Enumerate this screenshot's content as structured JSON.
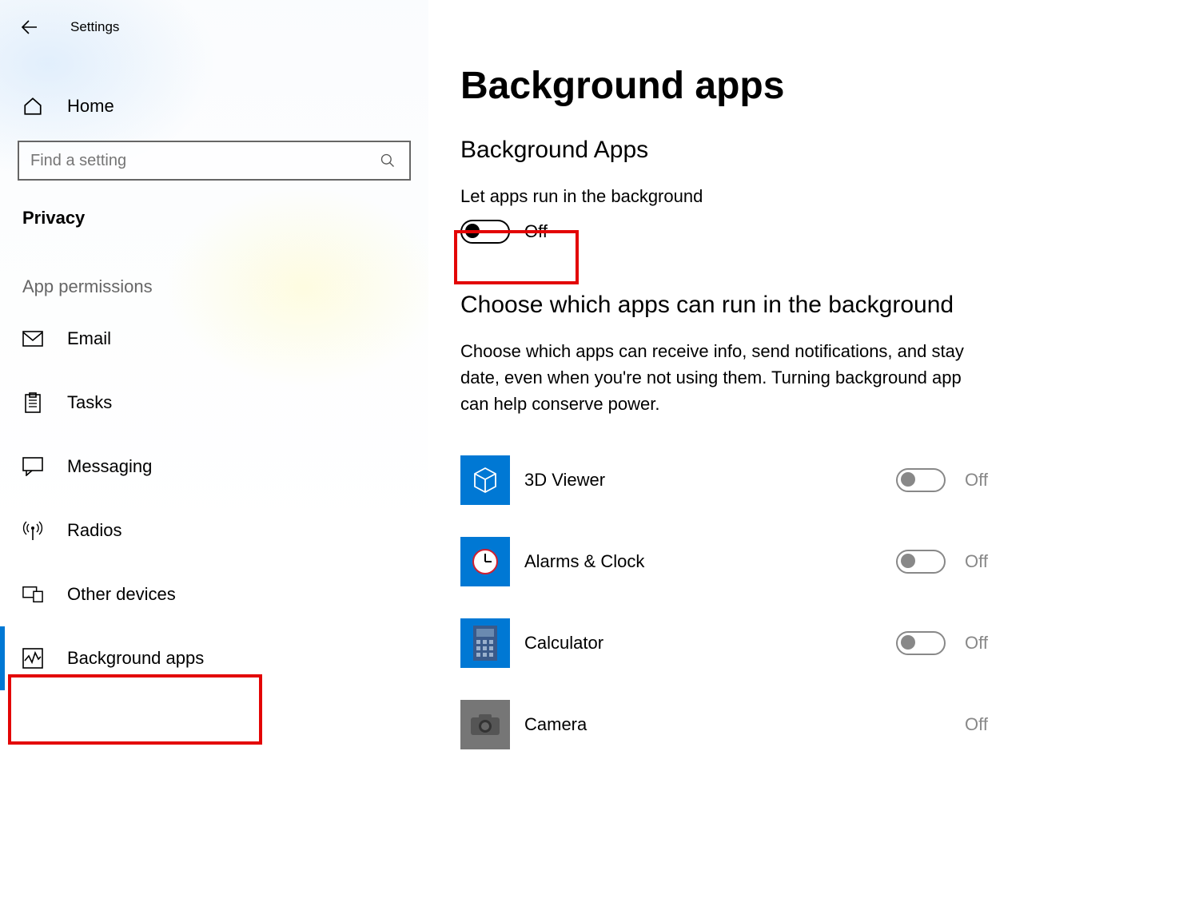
{
  "app_title": "Settings",
  "sidebar": {
    "home": "Home",
    "search_placeholder": "Find a setting",
    "category": "Privacy",
    "section": "App permissions",
    "items": [
      {
        "label": "Email"
      },
      {
        "label": "Tasks"
      },
      {
        "label": "Messaging"
      },
      {
        "label": "Radios"
      },
      {
        "label": "Other devices"
      },
      {
        "label": "Background apps"
      }
    ]
  },
  "main": {
    "page_title": "Background apps",
    "sub_title": "Background Apps",
    "master_label": "Let apps run in the background",
    "master_state": "Off",
    "choose_heading": "Choose which apps can run in the background",
    "choose_desc_l1": "Choose which apps can receive info, send notifications, and stay",
    "choose_desc_l2": "date, even when you're not using them. Turning background app",
    "choose_desc_l3": "can help conserve power.",
    "apps": [
      {
        "name": "3D Viewer",
        "state": "Off",
        "tile": "#0078d4"
      },
      {
        "name": "Alarms & Clock",
        "state": "Off",
        "tile": "#0078d4"
      },
      {
        "name": "Calculator",
        "state": "Off",
        "tile": "#0078d4"
      },
      {
        "name": "Camera",
        "state": "Off",
        "tile": "#767676"
      }
    ]
  }
}
